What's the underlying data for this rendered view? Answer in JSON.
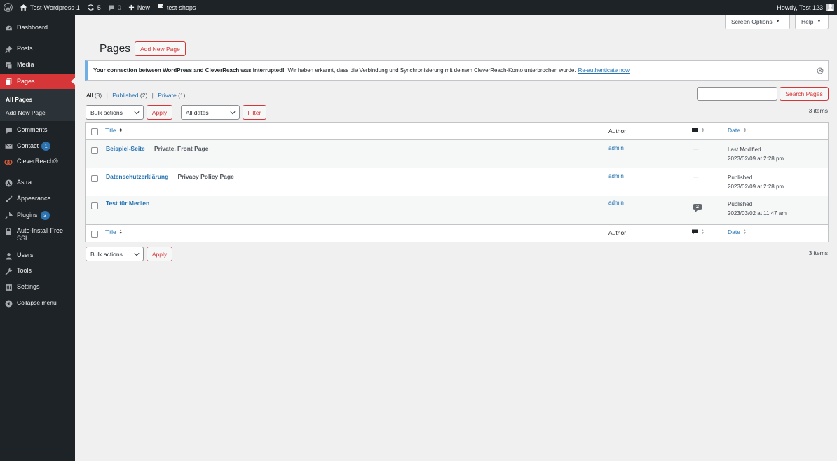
{
  "adminbar": {
    "site_name": "Test-Wordpress-1",
    "updates_count": "5",
    "comments_count": "0",
    "new_label": "New",
    "shop_label": "test-shops",
    "howdy": "Howdy, Test 123"
  },
  "sidebar": {
    "items": [
      {
        "label": "Dashboard",
        "icon": "dashboard-icon"
      },
      {
        "label": "Posts",
        "icon": "pin-icon"
      },
      {
        "label": "Media",
        "icon": "media-icon"
      },
      {
        "label": "Pages",
        "icon": "pages-icon"
      },
      {
        "label": "Comments",
        "icon": "comment-icon"
      },
      {
        "label": "Contact",
        "icon": "mail-icon",
        "badge": "1"
      },
      {
        "label": "CleverReach®",
        "icon": "cleverreach-icon"
      },
      {
        "label": "Astra",
        "icon": "astra-icon"
      },
      {
        "label": "Appearance",
        "icon": "brush-icon"
      },
      {
        "label": "Plugins",
        "icon": "plug-icon",
        "badge": "3"
      },
      {
        "label": "Auto-Install Free SSL",
        "icon": "lock-icon"
      },
      {
        "label": "Users",
        "icon": "user-icon"
      },
      {
        "label": "Tools",
        "icon": "wrench-icon"
      },
      {
        "label": "Settings",
        "icon": "settings-icon"
      },
      {
        "label": "Collapse menu",
        "icon": "collapse-icon"
      }
    ],
    "submenu": [
      {
        "label": "All Pages"
      },
      {
        "label": "Add New Page"
      }
    ]
  },
  "screen_options_label": "Screen Options",
  "help_label": "Help",
  "page_title": "Pages",
  "add_new_label": "Add New Page",
  "notice": {
    "strong": "Your connection between WordPress and CleverReach was interrupted!",
    "text": "Wir haben erkannt, dass die Verbindung und Synchronisierung mit deinem CleverReach-Konto unterbrochen wurde.",
    "link": "Re-authenticate now"
  },
  "views": {
    "all": "All",
    "all_count": "(3)",
    "published": "Published",
    "published_count": "(2)",
    "private": "Private",
    "private_count": "(1)",
    "separator": "|"
  },
  "search_button": "Search Pages",
  "bulk_actions": "Bulk actions",
  "apply_label": "Apply",
  "all_dates": "All dates",
  "filter_label": "Filter",
  "items_count": "3 items",
  "columns": {
    "title": "Title",
    "author": "Author",
    "date": "Date"
  },
  "rows": [
    {
      "title": "Beispiel-Seite",
      "state": " — Private, Front Page",
      "author": "admin",
      "comments": "—",
      "date_status": "Last Modified",
      "date": "2023/02/09 at 2:28 pm"
    },
    {
      "title": "Datenschutzerklärung",
      "state": " — Privacy Policy Page",
      "author": "admin",
      "comments": "—",
      "date_status": "Published",
      "date": "2023/02/09 at 2:28 pm"
    },
    {
      "title": "Test für Medien",
      "state": "",
      "author": "admin",
      "comments": "2",
      "date_status": "Published",
      "date": "2023/03/02 at 11:47 am"
    }
  ],
  "colors": {
    "admin_dark": "#1d2327",
    "accent_red": "#d63638",
    "link_blue": "#2271b1",
    "notice_blue": "#72aee6"
  }
}
